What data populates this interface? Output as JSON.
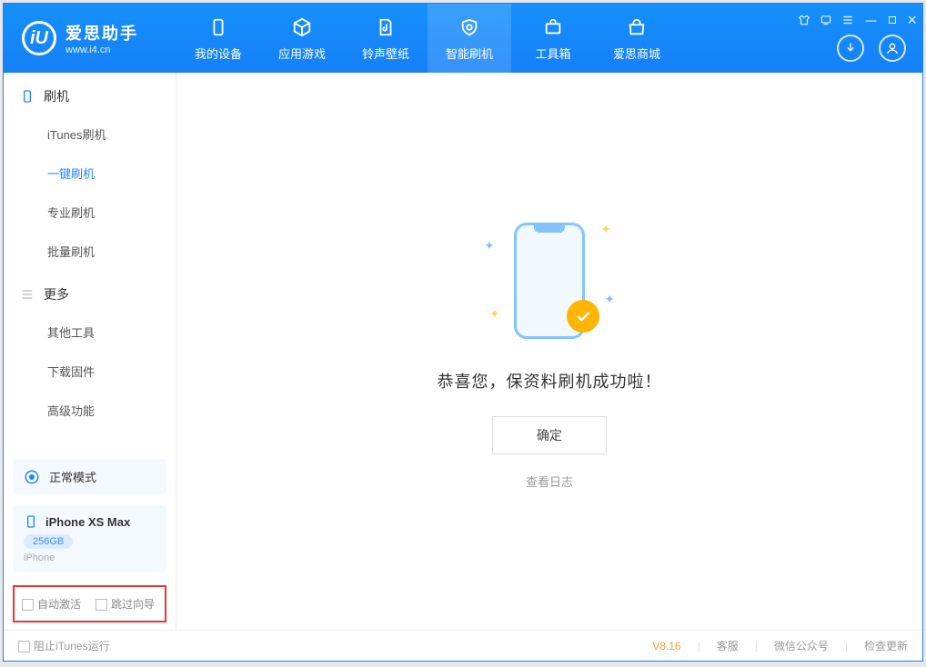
{
  "app": {
    "name_cn": "爱思助手",
    "name_en": "www.i4.cn",
    "logo_letter": "iU"
  },
  "nav": {
    "items": [
      {
        "label": "我的设备"
      },
      {
        "label": "应用游戏"
      },
      {
        "label": "铃声壁纸"
      },
      {
        "label": "智能刷机"
      },
      {
        "label": "工具箱"
      },
      {
        "label": "爱思商城"
      }
    ]
  },
  "sidebar": {
    "section1_title": "刷机",
    "section1_items": [
      "iTunes刷机",
      "一键刷机",
      "专业刷机",
      "批量刷机"
    ],
    "section2_title": "更多",
    "section2_items": [
      "其他工具",
      "下载固件",
      "高级功能"
    ],
    "mode_label": "正常模式",
    "device": {
      "name": "iPhone XS Max",
      "capacity": "256GB",
      "type": "iPhone"
    },
    "checkbox1": "自动激活",
    "checkbox2": "跳过向导"
  },
  "main": {
    "success_text": "恭喜您，保资料刷机成功啦！",
    "ok_button": "确定",
    "log_link": "查看日志"
  },
  "statusbar": {
    "block_itunes": "阻止iTunes运行",
    "version": "V8.16",
    "links": [
      "客服",
      "微信公众号",
      "检查更新"
    ]
  }
}
